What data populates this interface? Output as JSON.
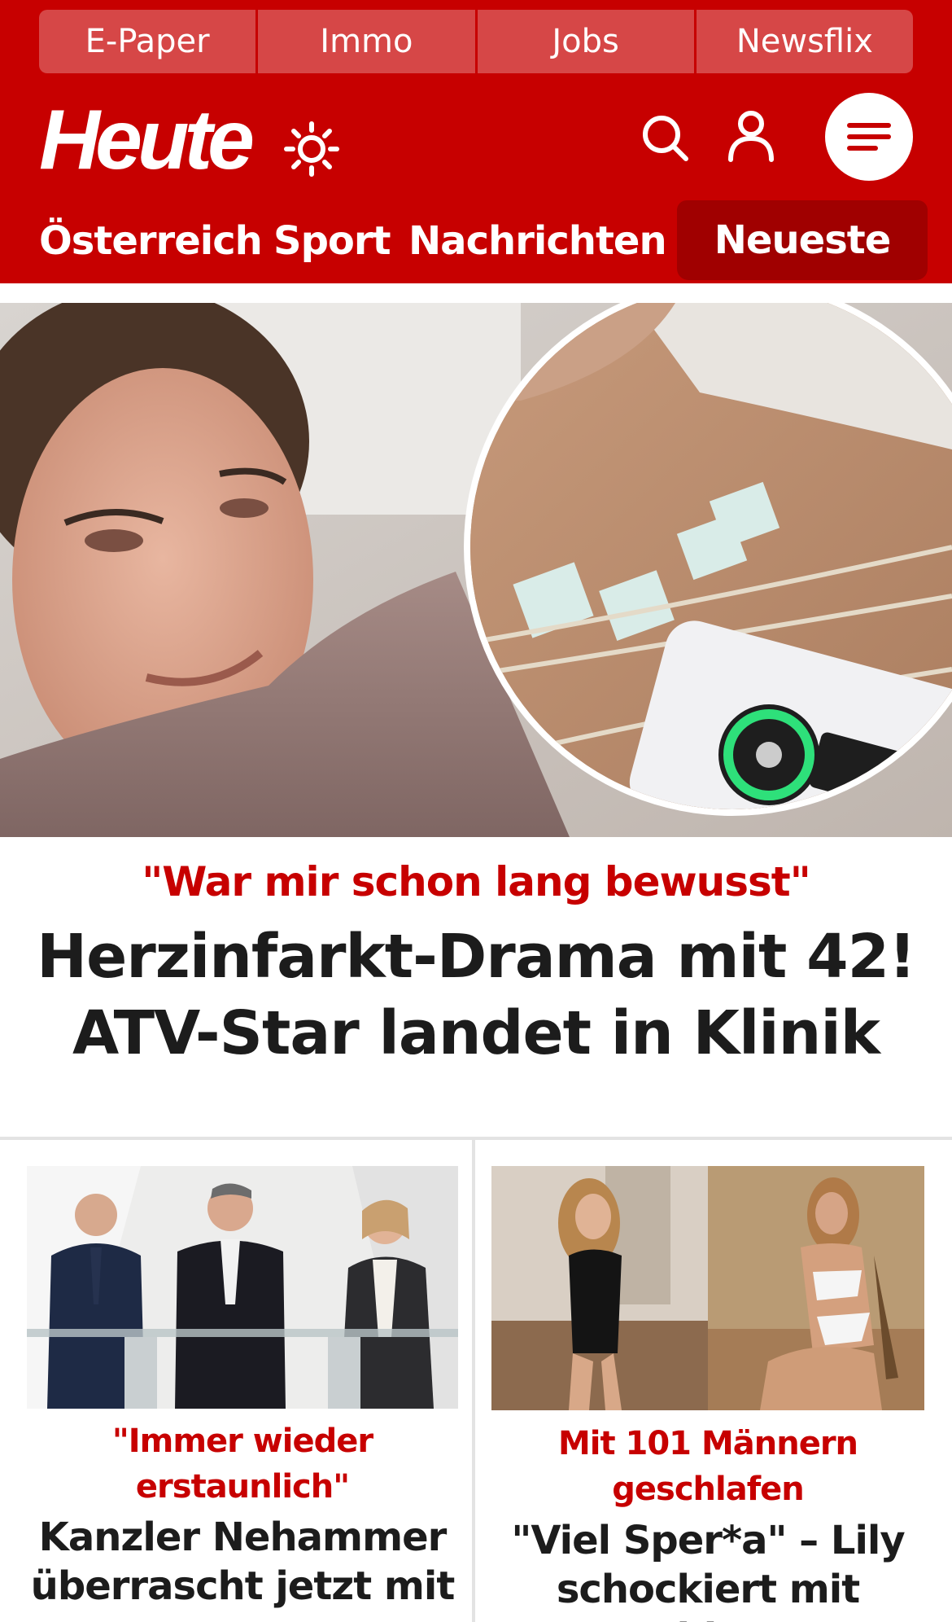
{
  "top_links": [
    "E-Paper",
    "Immo",
    "Jobs",
    "Newsflix"
  ],
  "brand": {
    "logo": "Heute",
    "weather_icon": "sun-icon"
  },
  "header_icons": [
    "search-icon",
    "user-icon",
    "menu-icon"
  ],
  "nav": {
    "items": [
      "Österreich",
      "Sport",
      "Nachrichten"
    ],
    "highlight": "Neueste"
  },
  "hero": {
    "image": "crying-woman-and-ecg-electrodes-photo",
    "kicker": "\"War mir schon lang bewusst\"",
    "title": "Herzinfarkt-Drama mit 42! ATV-Star landet in Klinik"
  },
  "teasers": [
    {
      "image": "politicians-press-conference-photo",
      "kicker": "\"Immer wieder erstaunlich\"",
      "title": "Kanzler Nehammer überrascht jetzt mit"
    },
    {
      "image": "swimsuit-model-photos",
      "kicker": "Mit 101 Männern geschlafen",
      "title": "\"Viel Sper*a\" – Lily schockiert mit Video"
    }
  ],
  "colors": {
    "brand_red": "#c70000",
    "nav_highlight": "#a00000",
    "text_dark": "#1c1c1c"
  }
}
